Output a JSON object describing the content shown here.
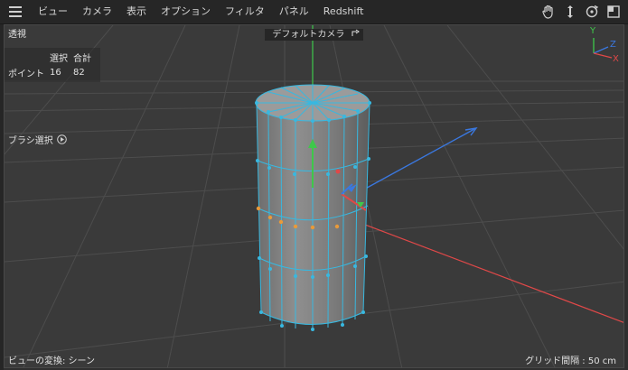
{
  "menubar": {
    "items": [
      "ビュー",
      "カメラ",
      "表示",
      "オプション",
      "フィルタ",
      "パネル",
      "Redshift"
    ],
    "right_icons": [
      "hand-icon",
      "move-arrows-icon",
      "rotate-icon",
      "maximize-icon"
    ]
  },
  "viewport": {
    "projection": "透視",
    "camera": "デフォルトカメラ",
    "stats": {
      "col_selected": "選択",
      "col_total": "合計",
      "row_label": "ポイント",
      "selected": "16",
      "total": "82"
    },
    "tool": "ブラシ選択",
    "transform": "ビューの変換: シーン",
    "grid_spacing": "グリッド間隔 : 50 cm",
    "axis_labels": {
      "y": "Y",
      "z": "Z",
      "x": "X"
    }
  },
  "colors": {
    "axis_x": "#e04848",
    "axis_y": "#3ec84a",
    "axis_z": "#3a78e0",
    "wire": "#38b8e0",
    "selected_point": "#e89a3a"
  }
}
